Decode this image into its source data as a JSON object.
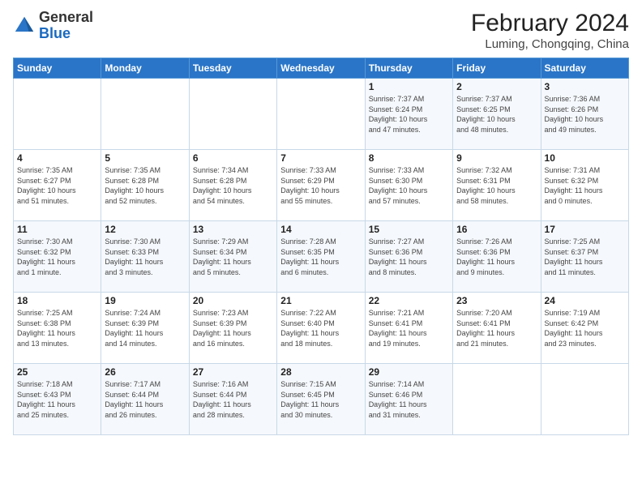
{
  "logo": {
    "text_general": "General",
    "text_blue": "Blue"
  },
  "header": {
    "title": "February 2024",
    "subtitle": "Luming, Chongqing, China"
  },
  "weekdays": [
    "Sunday",
    "Monday",
    "Tuesday",
    "Wednesday",
    "Thursday",
    "Friday",
    "Saturday"
  ],
  "weeks": [
    [
      {
        "day": "",
        "info": ""
      },
      {
        "day": "",
        "info": ""
      },
      {
        "day": "",
        "info": ""
      },
      {
        "day": "",
        "info": ""
      },
      {
        "day": "1",
        "info": "Sunrise: 7:37 AM\nSunset: 6:24 PM\nDaylight: 10 hours\nand 47 minutes."
      },
      {
        "day": "2",
        "info": "Sunrise: 7:37 AM\nSunset: 6:25 PM\nDaylight: 10 hours\nand 48 minutes."
      },
      {
        "day": "3",
        "info": "Sunrise: 7:36 AM\nSunset: 6:26 PM\nDaylight: 10 hours\nand 49 minutes."
      }
    ],
    [
      {
        "day": "4",
        "info": "Sunrise: 7:35 AM\nSunset: 6:27 PM\nDaylight: 10 hours\nand 51 minutes."
      },
      {
        "day": "5",
        "info": "Sunrise: 7:35 AM\nSunset: 6:28 PM\nDaylight: 10 hours\nand 52 minutes."
      },
      {
        "day": "6",
        "info": "Sunrise: 7:34 AM\nSunset: 6:28 PM\nDaylight: 10 hours\nand 54 minutes."
      },
      {
        "day": "7",
        "info": "Sunrise: 7:33 AM\nSunset: 6:29 PM\nDaylight: 10 hours\nand 55 minutes."
      },
      {
        "day": "8",
        "info": "Sunrise: 7:33 AM\nSunset: 6:30 PM\nDaylight: 10 hours\nand 57 minutes."
      },
      {
        "day": "9",
        "info": "Sunrise: 7:32 AM\nSunset: 6:31 PM\nDaylight: 10 hours\nand 58 minutes."
      },
      {
        "day": "10",
        "info": "Sunrise: 7:31 AM\nSunset: 6:32 PM\nDaylight: 11 hours\nand 0 minutes."
      }
    ],
    [
      {
        "day": "11",
        "info": "Sunrise: 7:30 AM\nSunset: 6:32 PM\nDaylight: 11 hours\nand 1 minute."
      },
      {
        "day": "12",
        "info": "Sunrise: 7:30 AM\nSunset: 6:33 PM\nDaylight: 11 hours\nand 3 minutes."
      },
      {
        "day": "13",
        "info": "Sunrise: 7:29 AM\nSunset: 6:34 PM\nDaylight: 11 hours\nand 5 minutes."
      },
      {
        "day": "14",
        "info": "Sunrise: 7:28 AM\nSunset: 6:35 PM\nDaylight: 11 hours\nand 6 minutes."
      },
      {
        "day": "15",
        "info": "Sunrise: 7:27 AM\nSunset: 6:36 PM\nDaylight: 11 hours\nand 8 minutes."
      },
      {
        "day": "16",
        "info": "Sunrise: 7:26 AM\nSunset: 6:36 PM\nDaylight: 11 hours\nand 9 minutes."
      },
      {
        "day": "17",
        "info": "Sunrise: 7:25 AM\nSunset: 6:37 PM\nDaylight: 11 hours\nand 11 minutes."
      }
    ],
    [
      {
        "day": "18",
        "info": "Sunrise: 7:25 AM\nSunset: 6:38 PM\nDaylight: 11 hours\nand 13 minutes."
      },
      {
        "day": "19",
        "info": "Sunrise: 7:24 AM\nSunset: 6:39 PM\nDaylight: 11 hours\nand 14 minutes."
      },
      {
        "day": "20",
        "info": "Sunrise: 7:23 AM\nSunset: 6:39 PM\nDaylight: 11 hours\nand 16 minutes."
      },
      {
        "day": "21",
        "info": "Sunrise: 7:22 AM\nSunset: 6:40 PM\nDaylight: 11 hours\nand 18 minutes."
      },
      {
        "day": "22",
        "info": "Sunrise: 7:21 AM\nSunset: 6:41 PM\nDaylight: 11 hours\nand 19 minutes."
      },
      {
        "day": "23",
        "info": "Sunrise: 7:20 AM\nSunset: 6:41 PM\nDaylight: 11 hours\nand 21 minutes."
      },
      {
        "day": "24",
        "info": "Sunrise: 7:19 AM\nSunset: 6:42 PM\nDaylight: 11 hours\nand 23 minutes."
      }
    ],
    [
      {
        "day": "25",
        "info": "Sunrise: 7:18 AM\nSunset: 6:43 PM\nDaylight: 11 hours\nand 25 minutes."
      },
      {
        "day": "26",
        "info": "Sunrise: 7:17 AM\nSunset: 6:44 PM\nDaylight: 11 hours\nand 26 minutes."
      },
      {
        "day": "27",
        "info": "Sunrise: 7:16 AM\nSunset: 6:44 PM\nDaylight: 11 hours\nand 28 minutes."
      },
      {
        "day": "28",
        "info": "Sunrise: 7:15 AM\nSunset: 6:45 PM\nDaylight: 11 hours\nand 30 minutes."
      },
      {
        "day": "29",
        "info": "Sunrise: 7:14 AM\nSunset: 6:46 PM\nDaylight: 11 hours\nand 31 minutes."
      },
      {
        "day": "",
        "info": ""
      },
      {
        "day": "",
        "info": ""
      }
    ]
  ]
}
